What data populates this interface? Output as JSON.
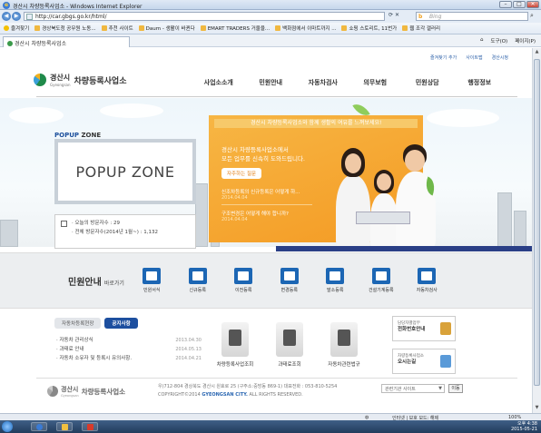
{
  "browser": {
    "window_title": "경산시 차량등록사업소 - Windows Internet Explorer",
    "url": "http://car.gbgs.go.kr/html/",
    "search_placeholder": "Bing",
    "favorites": [
      {
        "label": "즐겨찾기"
      },
      {
        "label": "경상북도청 공무원 노동..."
      },
      {
        "label": "추천 사이트"
      },
      {
        "label": "Daum - 생활이 바뀐다"
      },
      {
        "label": "EMART TRADERS 거울을..."
      },
      {
        "label": "백화점에서 이마트까지 ..."
      },
      {
        "label": "쇼핑 스토리트, 11번가"
      },
      {
        "label": "웹 조각 갤러리"
      }
    ],
    "tab_label": "경산시 차량등록사업소",
    "commands": [
      "도구(O)",
      "페이지(P)"
    ],
    "status_left": "인터넷 | 보호 모드: 해제",
    "zoom": "100%"
  },
  "site": {
    "utility_links": [
      "즐겨찾기 추가",
      "사이트맵",
      "경산시청"
    ],
    "logo_city": "경산시",
    "logo_city_en": "Gyeongsan",
    "logo_office": "차량등록사업소",
    "gnb": [
      "사업소소개",
      "민원안내",
      "자동차검사",
      "의무보험",
      "민원상담",
      "행정정보"
    ],
    "popup_title_1": "POPUP",
    "popup_title_2": "ZONE",
    "popup_zone_text": "POPUP ZONE",
    "visitors": {
      "today": "· 오늘의 방문자수 : 29",
      "total": "· 전체 방문자수(2014년 1월~) : 1,132"
    },
    "banner": {
      "head": "경산시 차량등록사업소와 함께 생활의 여유를 느껴보세요!",
      "line1": "경산시 차량등록사업소에서",
      "line2": "모든 업무를 신속히 도와드립니다.",
      "pill": "자주하는 질문",
      "news": [
        {
          "title": "신조차등록의 신규등록은 어떻게 하...",
          "date": "2014.04.04"
        },
        {
          "title": "구조변경은 어떻게 해야 합니까?",
          "date": "2014.04.04"
        }
      ]
    },
    "quick": {
      "title": "민원안내",
      "subtitle": "바로가기",
      "items": [
        "민원서식",
        "신규등록",
        "이전등록",
        "변경등록",
        "말소등록",
        "건설기계등록",
        "자동차검사"
      ]
    },
    "notice": {
      "tabs": [
        "자동차등록현장",
        "공지사항"
      ],
      "items": [
        {
          "text": "· 자동차 관리상식",
          "date": "2013.04.30"
        },
        {
          "text": "· 과태료 안내",
          "date": "2014.05.13"
        },
        {
          "text": "· 자동차 소유자 및 등록시 유의사항.",
          "date": "2014.04.21"
        }
      ]
    },
    "tiles": [
      "차량등록사업조회",
      "과태료조회",
      "자동차관련법규"
    ],
    "side_boxes": [
      {
        "small": "담당자별업무",
        "title": "전화번호안내"
      },
      {
        "small": "차량등록사업소",
        "title": "오시는길"
      }
    ],
    "footer": {
      "logo_city": "경산시",
      "logo_city_en": "Gyeongsan",
      "logo_office": "차량등록사업소",
      "address": "우)712-804 경상북도 경산시 원효로 25 (구주소:중방동 869-1) 대표전화 : 053-810-5254",
      "copyright_pre": "COPYRIGHT©2014",
      "copyright_brand": "GYEONGSAN CITY.",
      "copyright_post": "ALL RIGHTS RESERVED.",
      "related_select": "관련기관 사이트",
      "go_label": "이동"
    }
  },
  "taskbar": {
    "time": "오후 4:38",
    "date": "2015-05-21"
  },
  "colors": {
    "accent_blue": "#1d4f9f",
    "banner_orange": "#f49a23",
    "quick_icon_blue": "#1c66b4"
  }
}
